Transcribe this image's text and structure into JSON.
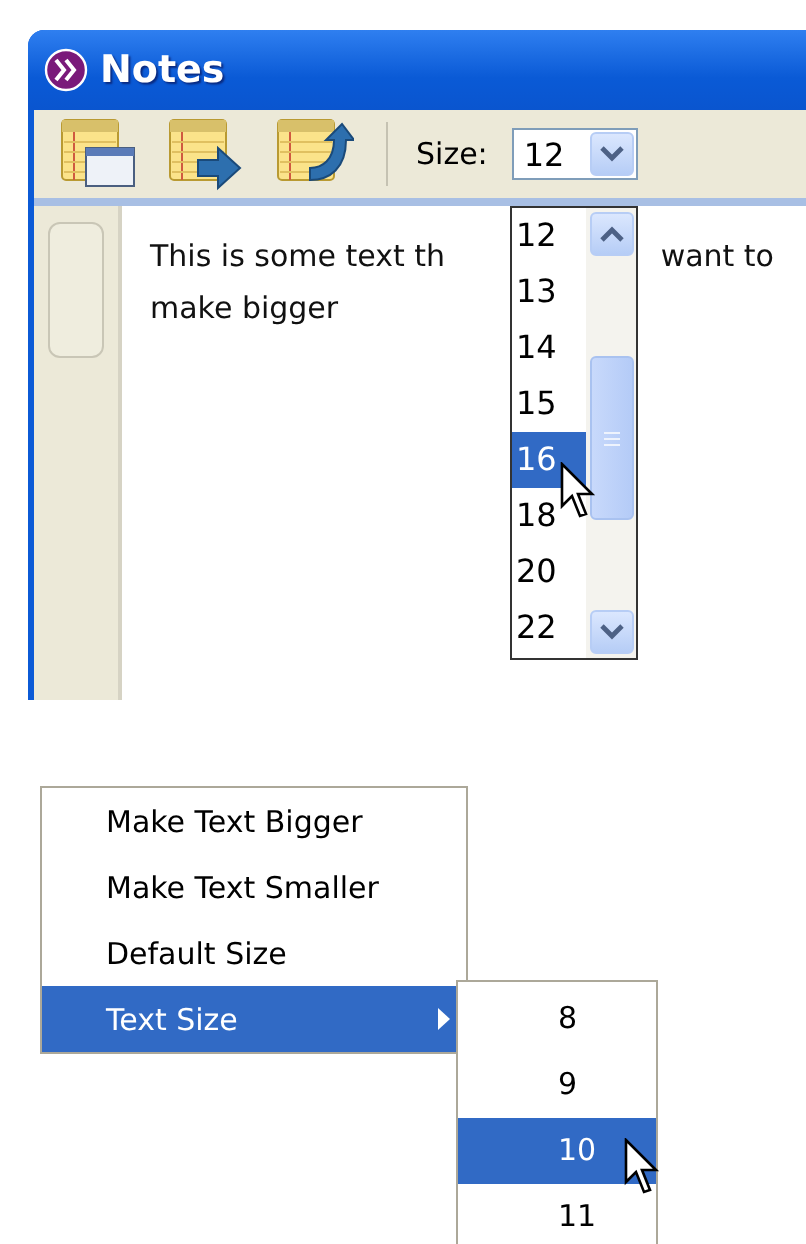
{
  "window": {
    "title": "Notes"
  },
  "toolbar": {
    "size_label": "Size:",
    "size_value": "12"
  },
  "size_list": {
    "items": [
      {
        "label": "12",
        "selected": false
      },
      {
        "label": "13",
        "selected": false
      },
      {
        "label": "14",
        "selected": false
      },
      {
        "label": "15",
        "selected": false
      },
      {
        "label": "16",
        "selected": true
      },
      {
        "label": "18",
        "selected": false
      },
      {
        "label": "20",
        "selected": false
      },
      {
        "label": "22",
        "selected": false
      }
    ]
  },
  "note": {
    "line_1_start": "This is some text th",
    "line_1_end": "want to",
    "line_2": "make bigger"
  },
  "context_menu": {
    "items": [
      {
        "label": "Make Text Bigger",
        "selected": false,
        "submenu": false
      },
      {
        "label": "Make Text Smaller",
        "selected": false,
        "submenu": false
      },
      {
        "label": "Default Size",
        "selected": false,
        "submenu": false
      },
      {
        "label": "Text Size",
        "selected": true,
        "submenu": true
      }
    ]
  },
  "submenu": {
    "items": [
      {
        "label": "8",
        "selected": false
      },
      {
        "label": "9",
        "selected": false
      },
      {
        "label": "10",
        "selected": true
      },
      {
        "label": "11",
        "selected": false
      }
    ]
  }
}
